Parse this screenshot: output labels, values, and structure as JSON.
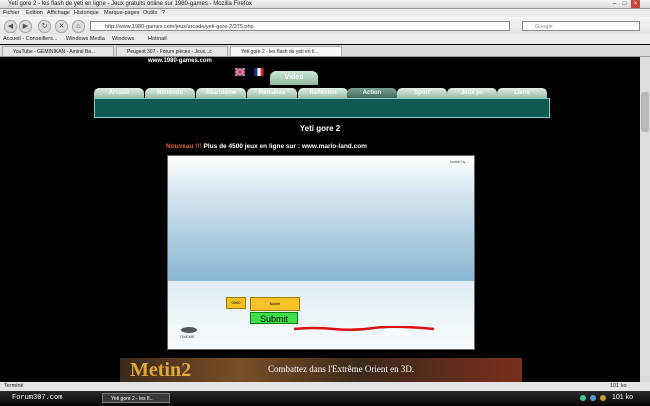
{
  "window": {
    "title": "Yeti gore 2 - les flash de yeti en ligne - Jeux gratuits online sur 1980-games - Mozilla Firefox"
  },
  "menu": [
    "Fichier",
    "Edition",
    "Affichage",
    "Historique",
    "Marque-pages",
    "Outils",
    "?"
  ],
  "nav": {
    "url": "http://www.1980-games.com/jeux/arcade/yeti-gore-2/275.php",
    "search_placeholder": "Google"
  },
  "bookmarks": [
    "Accueil - Conseillers...",
    "Windows Media",
    "Windows",
    "Hotmail"
  ],
  "tabs": [
    {
      "label": "YouTube - GEMINIKAN - Amiral Ba..."
    },
    {
      "label": "Peugeot 307 - Forum pièces - Jeux...c"
    },
    {
      "label": "Yeti gore 2 - les flash de yeti en li..."
    }
  ],
  "site": {
    "url_text": "www.1980-games.com",
    "video_label": "Video",
    "categories": [
      "Arcade",
      "Nintendo",
      "Abandonw",
      "Remakes",
      "Reflexion",
      "Action",
      "Sport",
      "Jeux pc",
      "Liens"
    ],
    "active_category": "Action",
    "page_title": "Yeti gore 2",
    "promo_new": "Nouveau !!!",
    "promo_text": " Plus de 4500 jeux en ligne sur :  www.mario-land.com"
  },
  "game": {
    "caption": "toolkit by ...",
    "score_label": "0000",
    "name_label": "Name",
    "submit_label": "Submit",
    "logo_text": "ONEME"
  },
  "banner": {
    "logo": "Metin2",
    "text": "Combattez dans l'Extrême Orient en 3D."
  },
  "status": {
    "left": "Terminé",
    "right": "101 ko"
  },
  "taskbar": {
    "forum": "Forum307.com",
    "item": "Yeti gore 2 - les fl...",
    "clock": "101 ko"
  },
  "colors": {
    "active_category": "#3f6d5e",
    "submit": "#3ee04a",
    "promo_new": "#e0642a"
  }
}
